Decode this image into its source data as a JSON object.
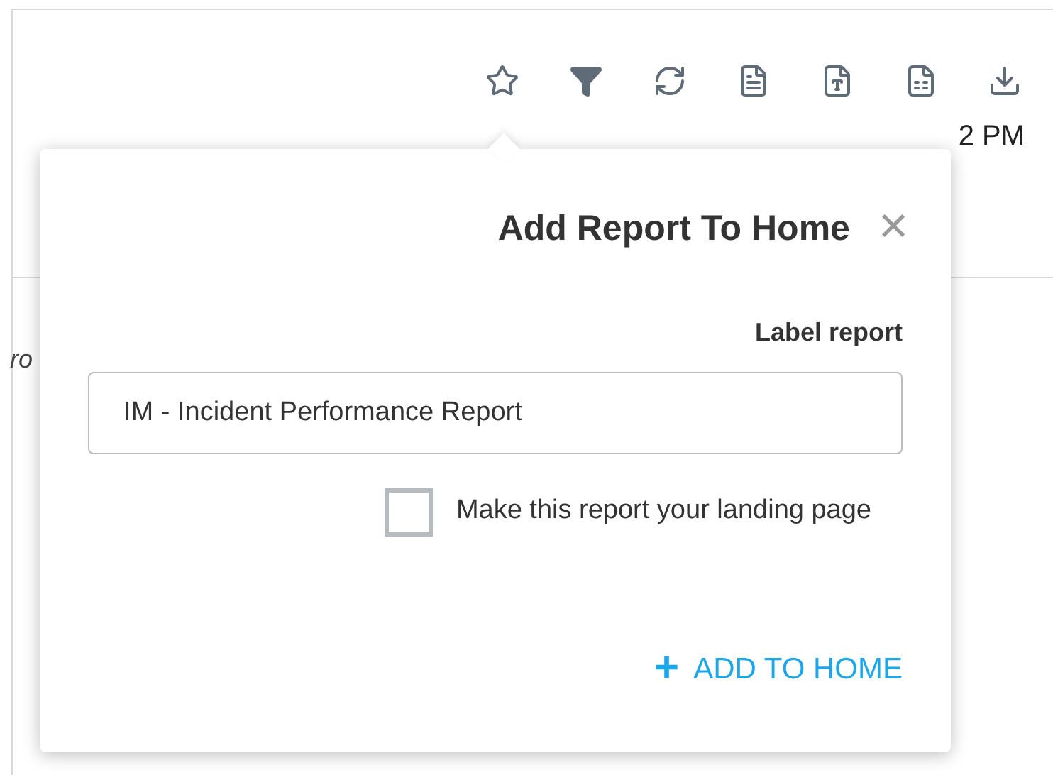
{
  "background": {
    "time_fragment": "2 PM",
    "text_fragment": "ro"
  },
  "dialog": {
    "title": "Add Report To Home",
    "close": "×",
    "field_label": "Label report",
    "field_value": "IM - Incident Performance Report",
    "checkbox": {
      "label": "Make this report your landing page",
      "checked": false
    },
    "action": {
      "icon": "+",
      "label": "ADD TO HOME"
    }
  }
}
